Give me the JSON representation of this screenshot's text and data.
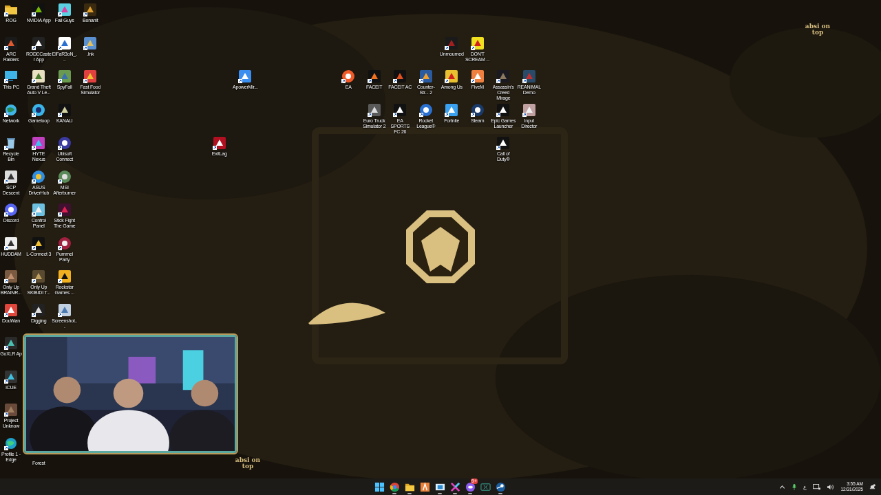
{
  "desktop": {
    "icons": [
      {
        "label": "ROG"
      },
      {
        "label": "ARC Raiders"
      },
      {
        "label": "This PC"
      },
      {
        "label": "Network"
      },
      {
        "label": "Recycle Bin"
      },
      {
        "label": "SCP Descent"
      },
      {
        "label": "Discord"
      },
      {
        "label": "HUDDAM"
      },
      {
        "label": "Only Up BRAINR..."
      },
      {
        "label": "DouWan"
      },
      {
        "label": "GoXLR Ap"
      },
      {
        "label": "iCUE"
      },
      {
        "label": "Project Unknow"
      },
      {
        "label": "Profile 1 - Edge"
      },
      {
        "label": "NVIDIA App"
      },
      {
        "label": "RODECaster App"
      },
      {
        "label": "Grand Theft Auto V Le..."
      },
      {
        "label": "Gameloop"
      },
      {
        "label": "HYTE Nexus"
      },
      {
        "label": "ASUS DriverHub"
      },
      {
        "label": "Control Panel"
      },
      {
        "label": "L-Connect 3"
      },
      {
        "label": "Only Up SKIBIDI T..."
      },
      {
        "label": "Digging"
      },
      {
        "label": "Forest"
      },
      {
        "label": "Fall Guys"
      },
      {
        "label": "ElFaR3oN_..."
      },
      {
        "label": "SpyFall"
      },
      {
        "label": "KANALI"
      },
      {
        "label": "Ubisoft Connect"
      },
      {
        "label": "MSI Afterburner"
      },
      {
        "label": "Stick Fight The Game"
      },
      {
        "label": "Pummel Party"
      },
      {
        "label": "Rockstar Games ..."
      },
      {
        "label": "Screenshot..."
      },
      {
        "label": "Bonanit"
      },
      {
        "label": ".lnk"
      },
      {
        "label": "Fast Food Simulator"
      },
      {
        "label": "ExitLag"
      },
      {
        "label": "ApowerMir..."
      },
      {
        "label": "Unmourned"
      },
      {
        "label": "DON'T SCREAM ..."
      },
      {
        "label": "EA"
      },
      {
        "label": "FACEIT"
      },
      {
        "label": "FACEIT AC"
      },
      {
        "label": "Counter-Str... 2"
      },
      {
        "label": "Among Us"
      },
      {
        "label": "FiveM"
      },
      {
        "label": "Assassin's Creed Mirage"
      },
      {
        "label": "REANIMAL Demo"
      },
      {
        "label": "Euro Truck Simulator 2"
      },
      {
        "label": "EA SPORTS FC 26"
      },
      {
        "label": "Rocket League®"
      },
      {
        "label": "Fortnite"
      },
      {
        "label": "Steam"
      },
      {
        "label": "Epic Games Launcher"
      },
      {
        "label": "Input Director"
      },
      {
        "label": "Call of Duty®"
      }
    ]
  },
  "corner_brand": "absi on top",
  "webcam": {
    "kind": "picture",
    "brand": "absi on top"
  },
  "taskbar": {
    "apps": [
      {
        "kind": "start",
        "running": false
      },
      {
        "kind": "browser",
        "running": true
      },
      {
        "kind": "files",
        "running": true
      },
      {
        "kind": "launcher",
        "running": false
      },
      {
        "kind": "window",
        "running": true
      },
      {
        "kind": "hyte",
        "running": true
      },
      {
        "kind": "chat",
        "running": true,
        "badge": "9+"
      },
      {
        "kind": "mixer",
        "running": false
      },
      {
        "kind": "steam",
        "running": true
      }
    ],
    "tray": {
      "language": "ع",
      "time": "3:55 AM",
      "date": "12/31/2025"
    }
  }
}
